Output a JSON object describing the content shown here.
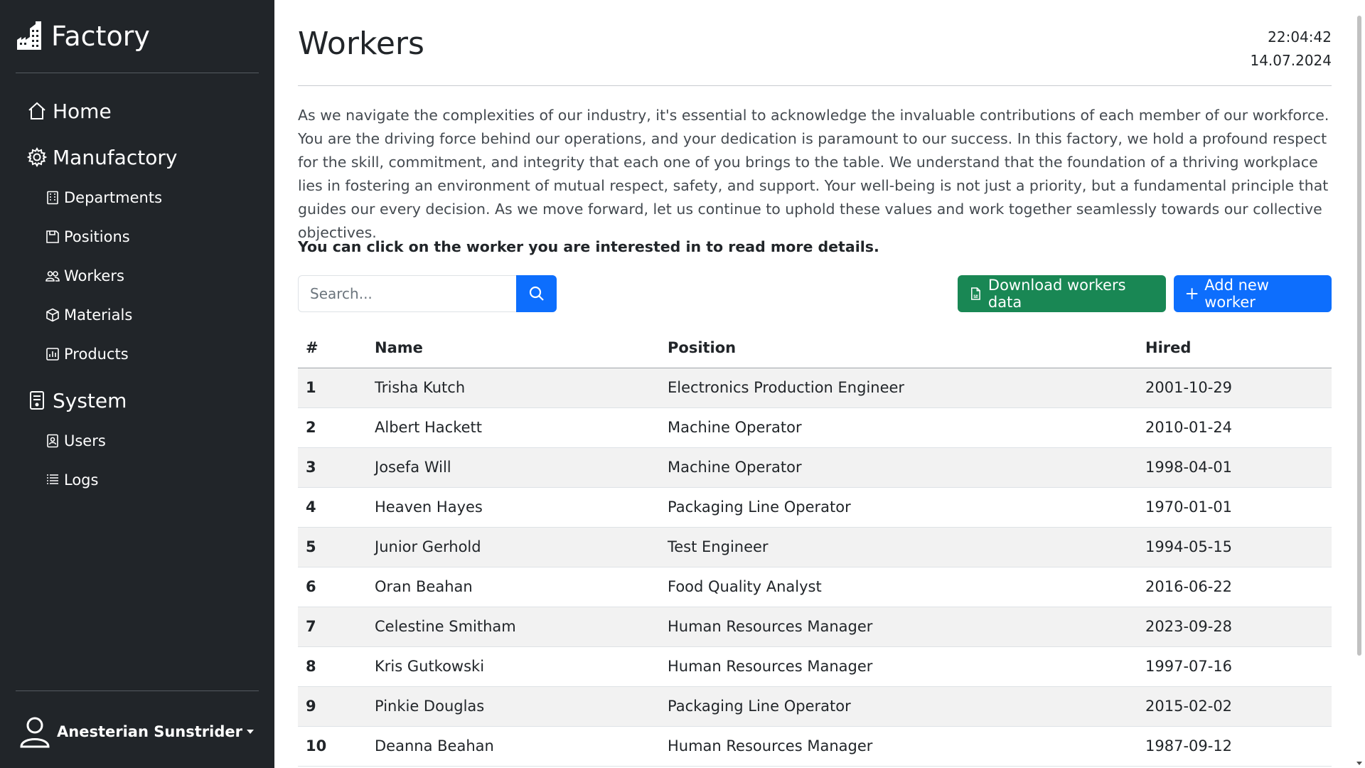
{
  "app": {
    "brand": "Factory"
  },
  "sidebar": {
    "sections": [
      {
        "label": "Home",
        "icon": "house-icon"
      },
      {
        "label": "Manufactory",
        "icon": "gear-icon",
        "items": [
          {
            "label": "Departments",
            "icon": "building-icon"
          },
          {
            "label": "Positions",
            "icon": "save-icon"
          },
          {
            "label": "Workers",
            "icon": "people-icon"
          },
          {
            "label": "Materials",
            "icon": "box-icon"
          },
          {
            "label": "Products",
            "icon": "chart-icon"
          }
        ]
      },
      {
        "label": "System",
        "icon": "server-icon",
        "items": [
          {
            "label": "Users",
            "icon": "person-badge-icon"
          },
          {
            "label": "Logs",
            "icon": "list-icon"
          }
        ]
      }
    ],
    "user": {
      "name": "Anesterian Sunstrider"
    }
  },
  "header": {
    "title": "Workers",
    "time": "22:04:42",
    "date": "14.07.2024"
  },
  "intro": "As we navigate the complexities of our industry, it's essential to acknowledge the invaluable contributions of each member of our workforce. You are the driving force behind our operations, and your dedication is paramount to our success. In this factory, we hold a profound respect for the skill, commitment, and integrity that each one of you brings to the table. We understand that the foundation of a thriving workplace lies in fostering an environment of mutual respect, safety, and support. Your well-being is not just a priority, but a fundamental principle that guides our every decision. As we move forward, let us continue to uphold these values and work together seamlessly towards our collective objectives.",
  "hint": "You can click on the worker you are interested in to read more details.",
  "search": {
    "placeholder": "Search..."
  },
  "actions": {
    "download_label": "Download workers data",
    "add_label": "Add new worker"
  },
  "colors": {
    "sidebar_bg": "#212529",
    "primary": "#0d6efd",
    "success": "#198754",
    "row_stripe": "#f2f2f2"
  },
  "table": {
    "columns": [
      "#",
      "Name",
      "Position",
      "Hired"
    ],
    "rows": [
      [
        "1",
        "Trisha Kutch",
        "Electronics Production Engineer",
        "2001-10-29"
      ],
      [
        "2",
        "Albert Hackett",
        "Machine Operator",
        "2010-01-24"
      ],
      [
        "3",
        "Josefa Will",
        "Machine Operator",
        "1998-04-01"
      ],
      [
        "4",
        "Heaven Hayes",
        "Packaging Line Operator",
        "1970-01-01"
      ],
      [
        "5",
        "Junior Gerhold",
        "Test Engineer",
        "1994-05-15"
      ],
      [
        "6",
        "Oran Beahan",
        "Food Quality Analyst",
        "2016-06-22"
      ],
      [
        "7",
        "Celestine Smitham",
        "Human Resources Manager",
        "2023-09-28"
      ],
      [
        "8",
        "Kris Gutkowski",
        "Human Resources Manager",
        "1997-07-16"
      ],
      [
        "9",
        "Pinkie Douglas",
        "Packaging Line Operator",
        "2015-02-02"
      ],
      [
        "10",
        "Deanna Beahan",
        "Human Resources Manager",
        "1987-09-12"
      ]
    ]
  }
}
